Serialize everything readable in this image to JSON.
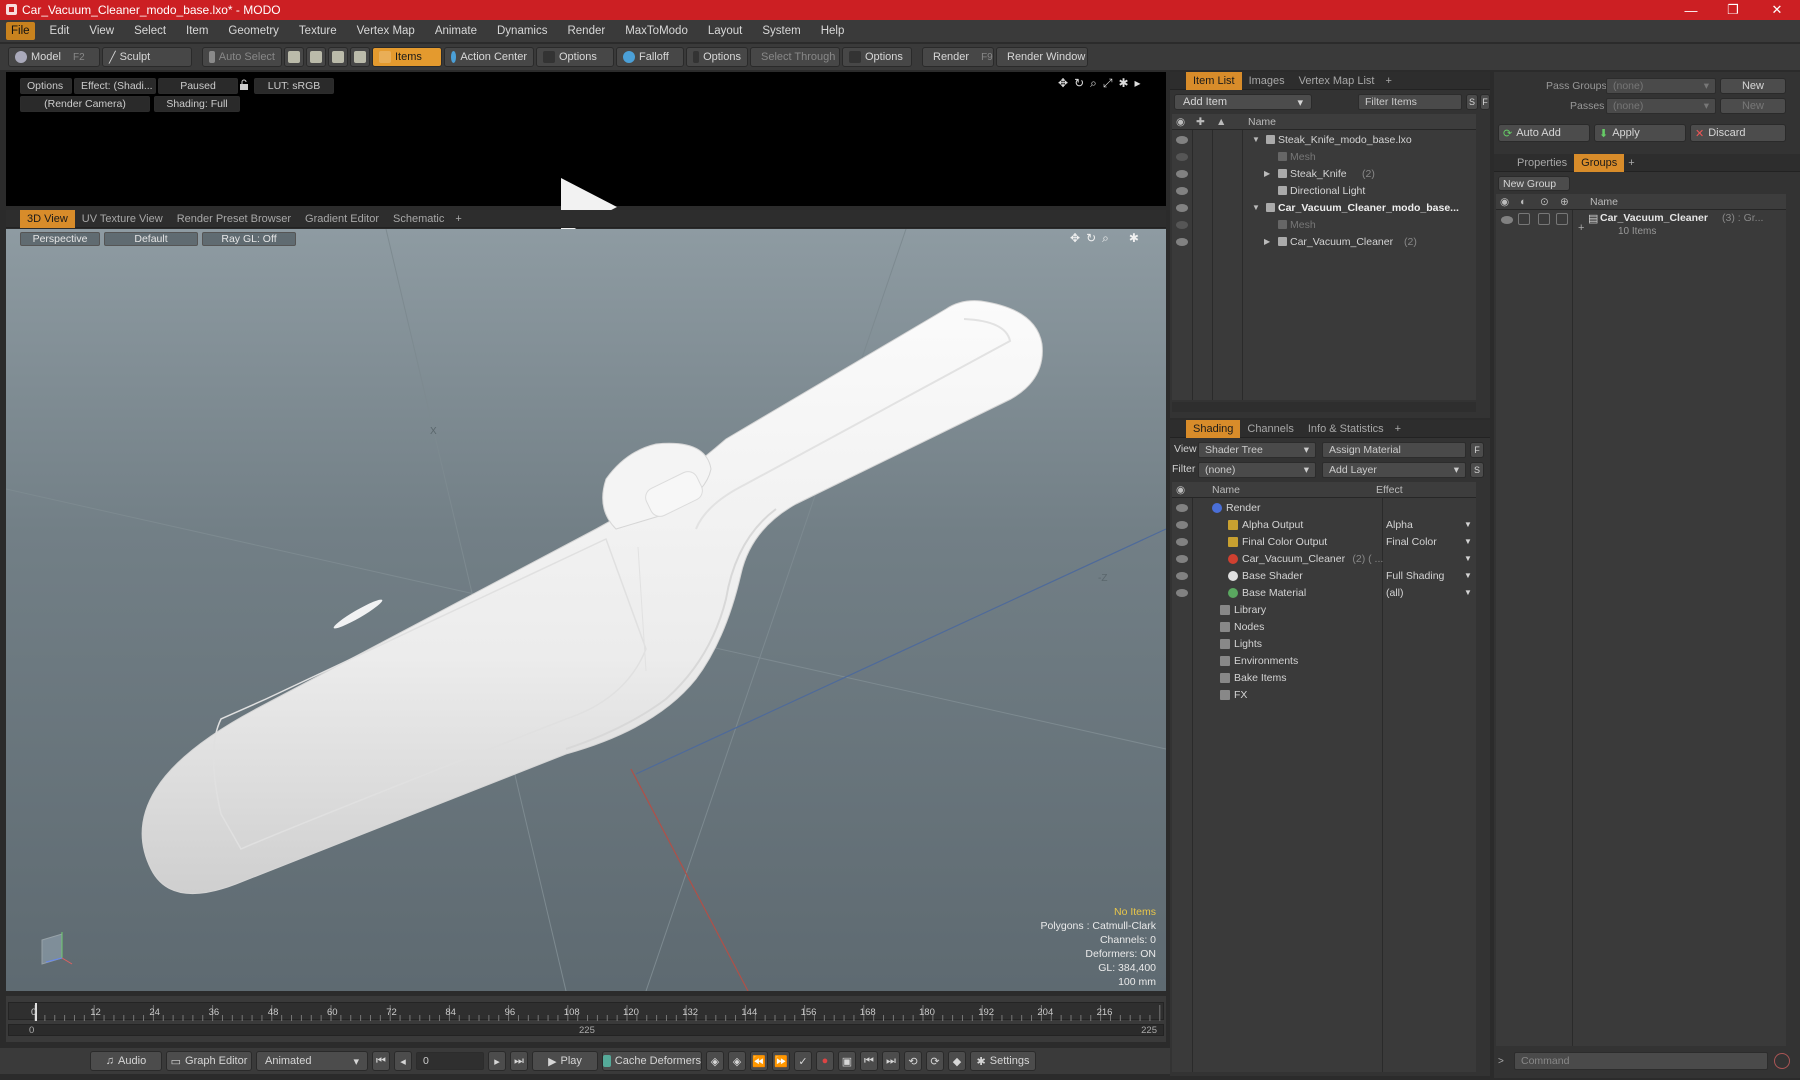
{
  "window": {
    "title": "Car_Vacuum_Cleaner_modo_base.lxo* - MODO",
    "controls": [
      "—",
      "❐",
      "✕"
    ]
  },
  "menu": [
    "File",
    "Edit",
    "View",
    "Select",
    "Item",
    "Geometry",
    "Texture",
    "Vertex Map",
    "Animate",
    "Dynamics",
    "Render",
    "MaxToModo",
    "Layout",
    "System",
    "Help"
  ],
  "toolbar": {
    "model": "Model",
    "model_key": "F2",
    "sculpt": "Sculpt",
    "auto_select": "Auto Select",
    "items": "Items",
    "action_center": "Action Center",
    "options1": "Options",
    "falloff": "Falloff",
    "options2": "Options",
    "select_through": "Select Through",
    "options3": "Options",
    "render": "Render",
    "render_key": "F9",
    "render_window": "Render Window"
  },
  "preview": {
    "options": "Options",
    "effect": "Effect: (Shadi...",
    "paused": "Paused",
    "lut": "LUT: sRGB",
    "camera": "(Render Camera)",
    "shading": "Shading: Full"
  },
  "viewport_tabs": [
    "3D View",
    "UV Texture View",
    "Render Preset Browser",
    "Gradient Editor",
    "Schematic",
    "+"
  ],
  "viewport": {
    "projection": "Perspective",
    "style": "Default",
    "raygl": "Ray GL: Off",
    "axis_x": "X",
    "axis_z": "-Z",
    "stats": {
      "items": "No Items",
      "polygons": "Polygons : Catmull-Clark",
      "channels": "Channels: 0",
      "deformers": "Deformers: ON",
      "gl": "GL: 384,400",
      "scale": "100 mm"
    }
  },
  "timeline": {
    "ticks": [
      "0",
      "12",
      "24",
      "36",
      "48",
      "60",
      "72",
      "84",
      "96",
      "108",
      "120",
      "132",
      "144",
      "156",
      "168",
      "180",
      "192",
      "204",
      "216"
    ],
    "start": "0",
    "mid": "225",
    "end": "225"
  },
  "transport": {
    "audio": "Audio",
    "graph_editor": "Graph Editor",
    "animated": "Animated",
    "frame": "0",
    "play": "Play",
    "cache_deformers": "Cache Deformers",
    "settings": "Settings"
  },
  "item_list": {
    "tabs": [
      "Item List",
      "Images",
      "Vertex Map List",
      "+"
    ],
    "add_item": "Add Item",
    "filter_items": "Filter Items",
    "s": "S",
    "f": "F",
    "col_name": "Name",
    "rows": [
      {
        "label": "Steak_Knife_modo_base.lxo",
        "bold": false,
        "dim": false,
        "indent": 0,
        "arrow": "▼"
      },
      {
        "label": "Mesh",
        "bold": false,
        "dim": true,
        "indent": 1,
        "arrow": ""
      },
      {
        "label": "Steak_Knife",
        "suffix": "(2)",
        "bold": false,
        "dim": false,
        "indent": 1,
        "arrow": "▶"
      },
      {
        "label": "Directional Light",
        "bold": false,
        "dim": false,
        "indent": 1,
        "arrow": ""
      },
      {
        "label": "Car_Vacuum_Cleaner_modo_base...",
        "bold": true,
        "dim": false,
        "indent": 0,
        "arrow": "▼"
      },
      {
        "label": "Mesh",
        "bold": false,
        "dim": true,
        "indent": 1,
        "arrow": ""
      },
      {
        "label": "Car_Vacuum_Cleaner",
        "suffix": "(2)",
        "bold": false,
        "dim": false,
        "indent": 1,
        "arrow": "▶"
      }
    ]
  },
  "shading": {
    "tabs": [
      "Shading",
      "Channels",
      "Info & Statistics",
      "+"
    ],
    "view_label": "View",
    "view_value": "Shader Tree",
    "assign_material": "Assign Material",
    "filter_label": "Filter",
    "filter_value": "(none)",
    "add_layer": "Add Layer",
    "f": "F",
    "s": "S",
    "col_name": "Name",
    "col_effect": "Effect",
    "rows": [
      {
        "label": "Render",
        "effect": "",
        "indent": 0
      },
      {
        "label": "Alpha Output",
        "effect": "Alpha",
        "indent": 1
      },
      {
        "label": "Final Color Output",
        "effect": "Final Color",
        "indent": 1
      },
      {
        "label": "Car_Vacuum_Cleaner",
        "suffix": "(2) ( ...",
        "effect": "",
        "indent": 1
      },
      {
        "label": "Base Shader",
        "effect": "Full Shading",
        "indent": 1
      },
      {
        "label": "Base Material",
        "effect": "(all)",
        "indent": 1
      },
      {
        "label": "Library",
        "effect": "",
        "indent": 0
      },
      {
        "label": "Nodes",
        "effect": "",
        "indent": 0
      },
      {
        "label": "Lights",
        "effect": "",
        "indent": 0
      },
      {
        "label": "Environments",
        "effect": "",
        "indent": 0
      },
      {
        "label": "Bake Items",
        "effect": "",
        "indent": 0
      },
      {
        "label": "FX",
        "effect": "",
        "indent": 0
      }
    ]
  },
  "groups_panel": {
    "pass_groups_label": "Pass Groups",
    "pass_groups_value": "(none)",
    "passes_label": "Passes",
    "passes_value": "(none)",
    "new": "New",
    "auto_add": "Auto Add",
    "apply": "Apply",
    "discard": "Discard",
    "tabs": [
      "Properties",
      "Groups",
      "+"
    ],
    "new_group": "New Group",
    "col_name": "Name",
    "group_name": "Car_Vacuum_Cleaner",
    "group_suffix": "(3) : Gr...",
    "group_items": "10 Items"
  },
  "command": {
    "placeholder": "Command"
  }
}
